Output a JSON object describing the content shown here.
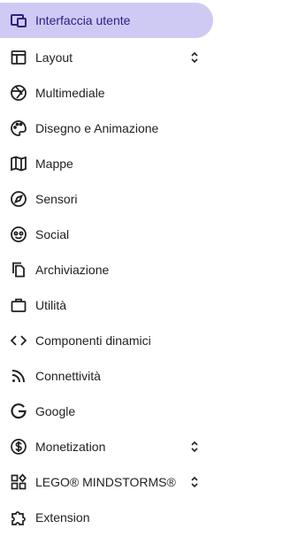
{
  "colors": {
    "active_bg": "#cfcaf4",
    "active_text": "#2b2183",
    "text": "#202124"
  },
  "sidebar": {
    "items": [
      {
        "label": "Interfaccia utente",
        "icon": "user-interface-icon",
        "active": true,
        "expandable": false
      },
      {
        "label": "Layout",
        "icon": "layout-icon",
        "active": false,
        "expandable": true
      },
      {
        "label": "Multimediale",
        "icon": "camera-aperture-icon",
        "active": false,
        "expandable": false
      },
      {
        "label": "Disegno e Animazione",
        "icon": "palette-icon",
        "active": false,
        "expandable": false
      },
      {
        "label": "Mappe",
        "icon": "map-icon",
        "active": false,
        "expandable": false
      },
      {
        "label": "Sensori",
        "icon": "compass-icon",
        "active": false,
        "expandable": false
      },
      {
        "label": "Social",
        "icon": "social-face-icon",
        "active": false,
        "expandable": false
      },
      {
        "label": "Archiviazione",
        "icon": "storage-copy-icon",
        "active": false,
        "expandable": false
      },
      {
        "label": "Utilità",
        "icon": "briefcase-icon",
        "active": false,
        "expandable": false
      },
      {
        "label": "Componenti dinamici",
        "icon": "code-icon",
        "active": false,
        "expandable": false
      },
      {
        "label": "Connettività",
        "icon": "rss-icon",
        "active": false,
        "expandable": false
      },
      {
        "label": "Google",
        "icon": "google-g-icon",
        "active": false,
        "expandable": false
      },
      {
        "label": "Monetization",
        "icon": "dollar-icon",
        "active": false,
        "expandable": true
      },
      {
        "label": "LEGO® MINDSTORMS®",
        "icon": "lego-blocks-icon",
        "active": false,
        "expandable": true
      },
      {
        "label": "Extension",
        "icon": "puzzle-icon",
        "active": false,
        "expandable": false
      }
    ]
  }
}
